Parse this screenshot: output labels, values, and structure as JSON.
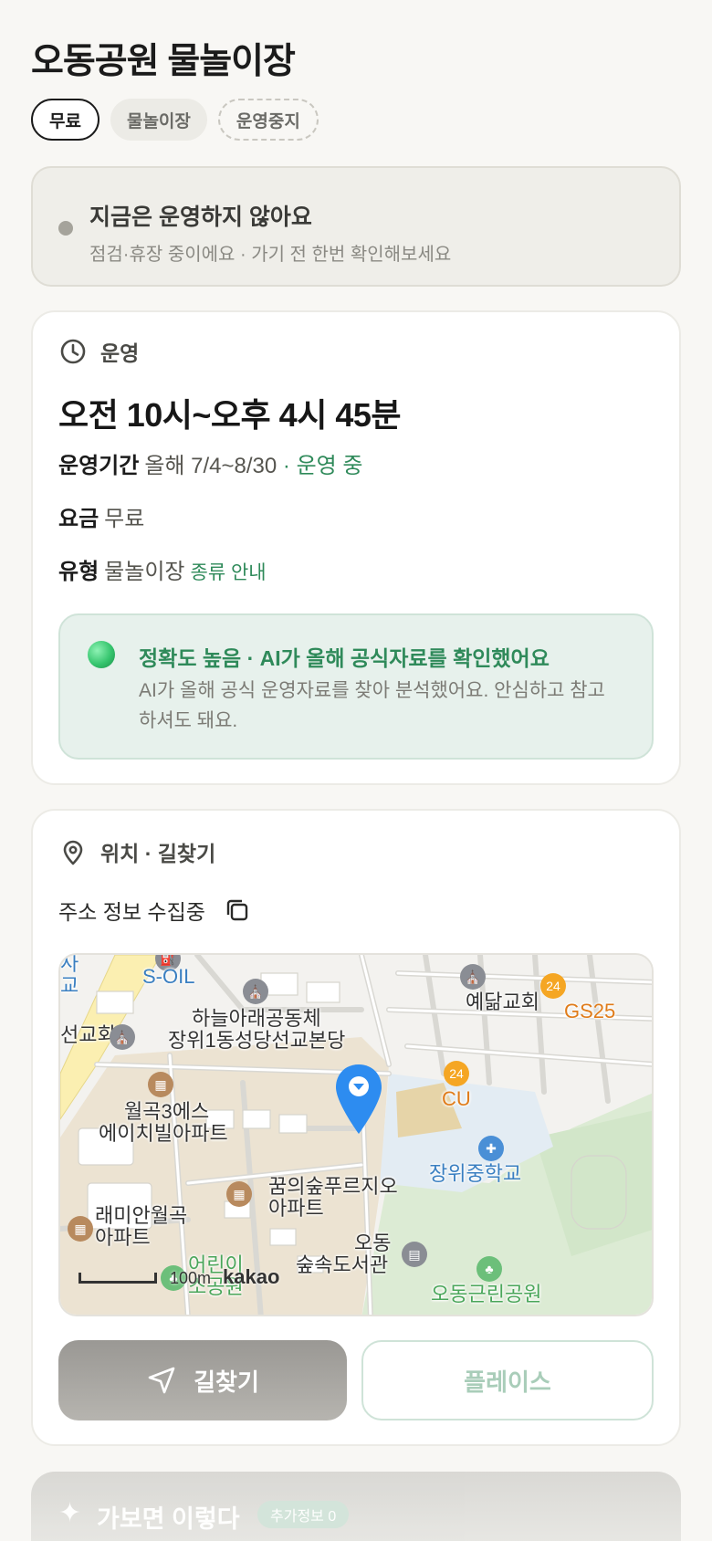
{
  "title": "오동공원 물놀이장",
  "chips": {
    "free": "무료",
    "category": "물놀이장",
    "status": "운영중지"
  },
  "notice": {
    "title": "지금은 운영하지 않아요",
    "subtitle": "점검·휴장 중이에요 · 가기 전 한번 확인해보세요"
  },
  "operation": {
    "section_label": "운영",
    "hours": "오전 10시~오후 4시 45분",
    "period_label": "운영기간",
    "period_value": "올해 7/4~8/30",
    "period_sep": " · ",
    "period_status": "운영 중",
    "fee_label": "요금",
    "fee_value": "무료",
    "type_label": "유형",
    "type_value": "물놀이장",
    "type_link": "종류 안내",
    "ai_title": "정확도 높음 · AI가 올해 공식자료를 확인했어요",
    "ai_desc": "AI가 올해 공식 운영자료를 찾아 분석했어요. 안심하고 참고하셔도 돼요."
  },
  "location": {
    "section_label": "위치 · 길찾기",
    "address": "주소 정보 수집중",
    "map": {
      "labels": {
        "soil": "S-OIL",
        "sa": "사",
        "gyo": "교",
        "seongyohoe": "선교회",
        "haneul": "하늘아래공동체",
        "jangwi_church": "장위1동성당선교본당",
        "yedam": "예닮교회",
        "gs25": "GS25",
        "cu": "CU",
        "wolgok1": "월곡3에스",
        "wolgok2": "에이치빌아파트",
        "kkum1": "꿈의숲푸르지오",
        "kkum2": "아파트",
        "jangwi_school": "장위중학교",
        "raemian1": "래미안월곡",
        "raemian2": "아파트",
        "odong1": "오동",
        "odong2": "숲속도서관",
        "park1": "어린이",
        "park2": "소공원",
        "odong_park": "오동근린공원"
      },
      "scale": "100m",
      "brand": "kakao"
    },
    "directions_button": "길찾기",
    "place_button": "플레이스"
  },
  "next_section": {
    "title": "가보면 이렇다",
    "badge": "추가정보 0"
  },
  "colors": {
    "accent_green": "#2f8a5a",
    "map_pin": "#2d8cf0",
    "notice_bg": "#efeee9"
  }
}
